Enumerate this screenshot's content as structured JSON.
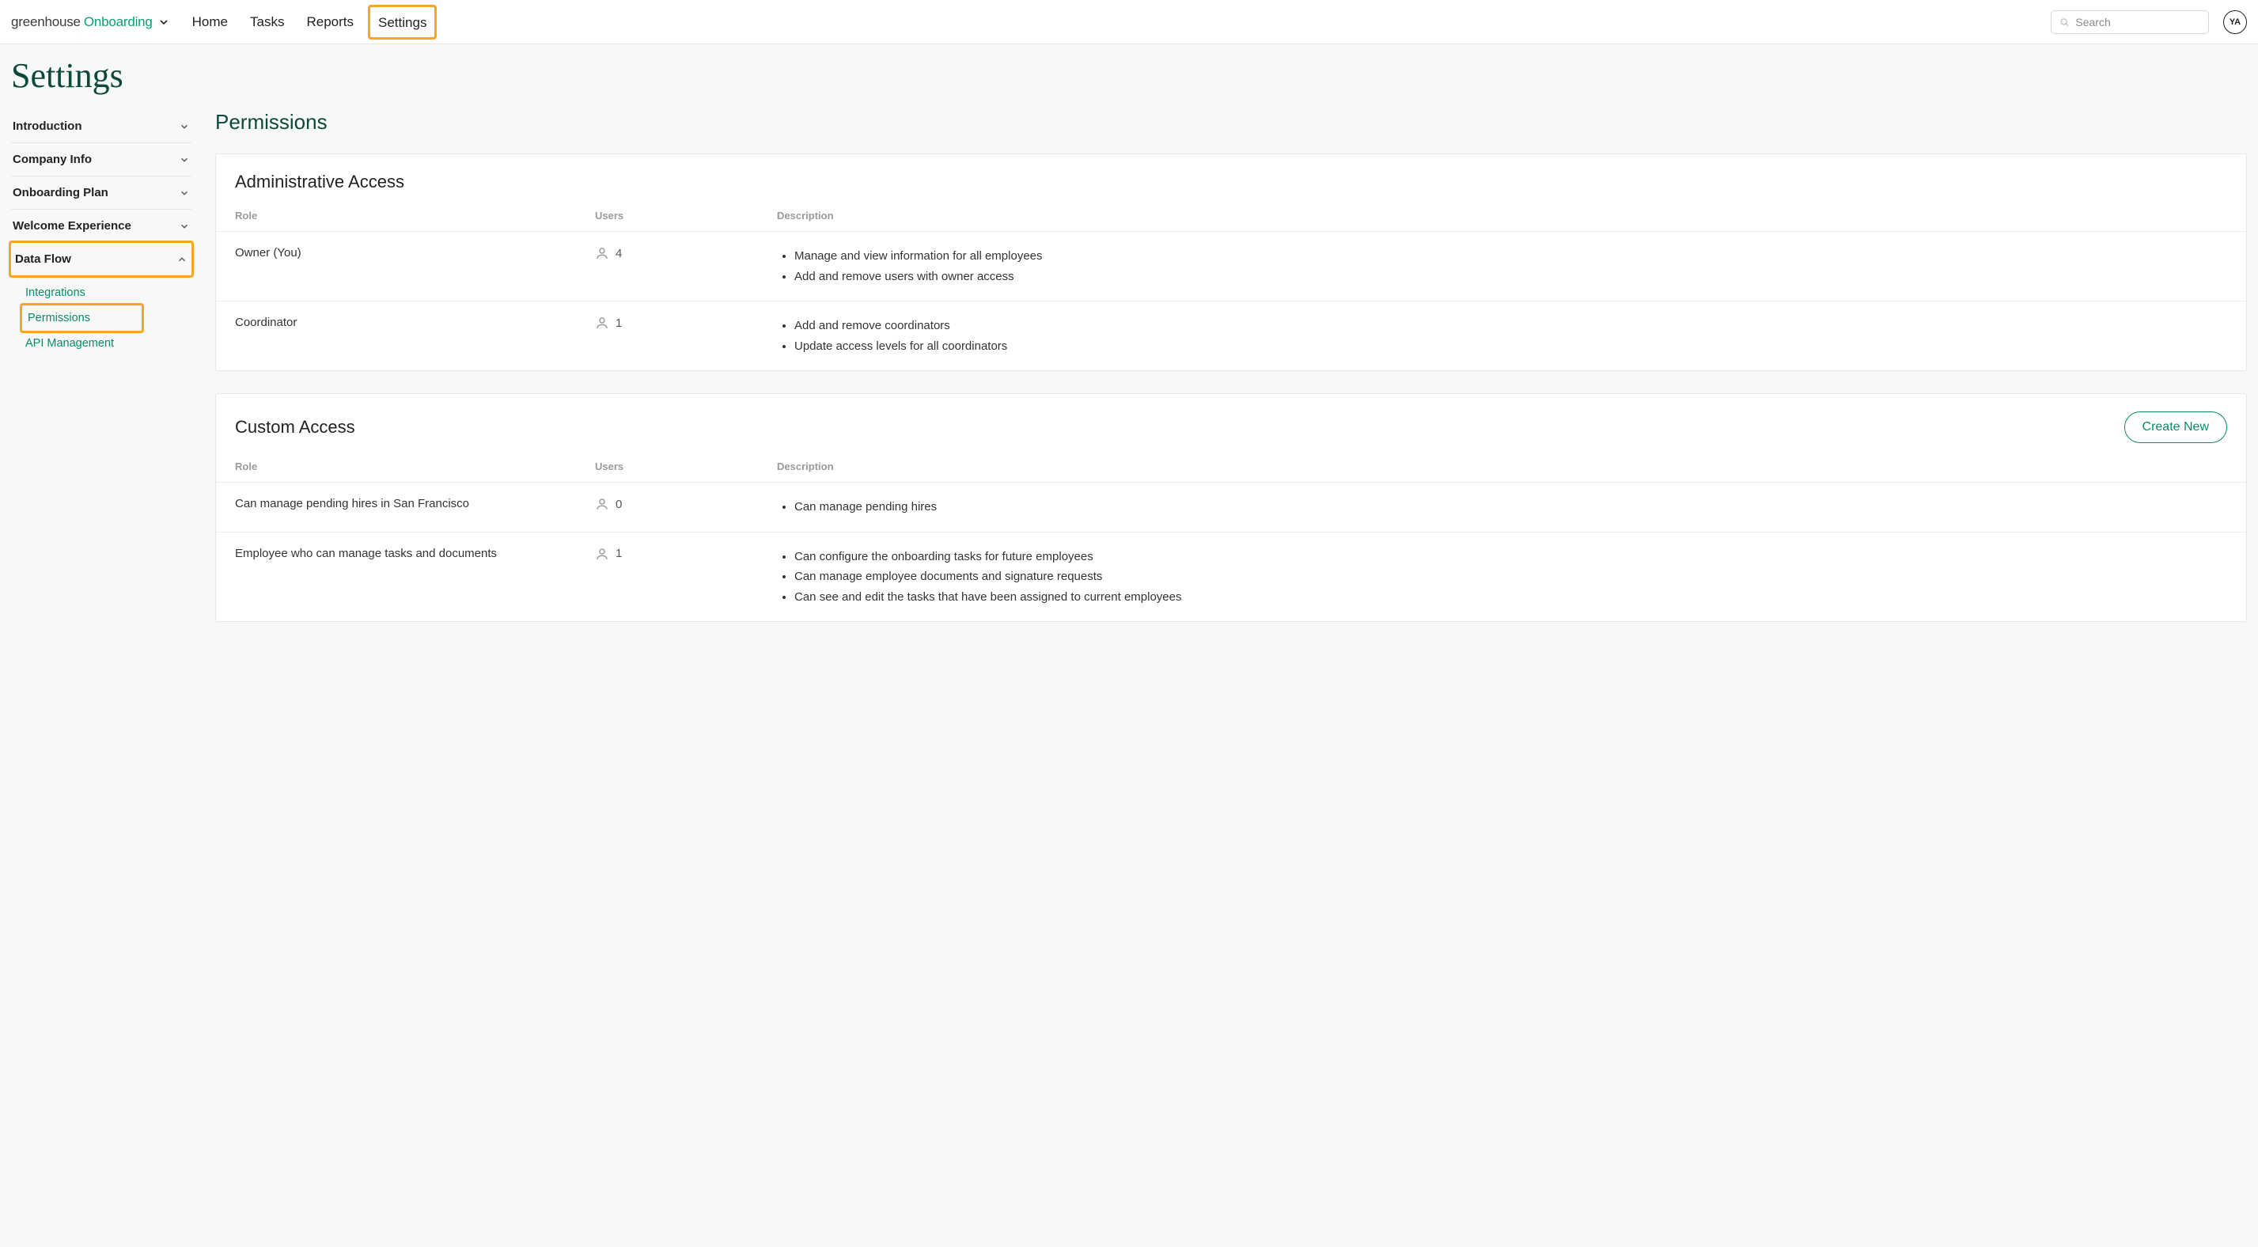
{
  "header": {
    "logo_primary": "greenhouse",
    "logo_secondary": "Onboarding",
    "nav": [
      "Home",
      "Tasks",
      "Reports",
      "Settings"
    ],
    "active_nav_index": 3,
    "search_placeholder": "Search",
    "avatar_initials": "YA"
  },
  "page": {
    "title": "Settings",
    "main_title": "Permissions"
  },
  "sidebar": {
    "groups": [
      {
        "label": "Introduction",
        "expanded": false
      },
      {
        "label": "Company Info",
        "expanded": false
      },
      {
        "label": "Onboarding Plan",
        "expanded": false
      },
      {
        "label": "Welcome Experience",
        "expanded": false
      },
      {
        "label": "Data Flow",
        "expanded": true,
        "highlight": true,
        "items": [
          {
            "label": "Integrations"
          },
          {
            "label": "Permissions",
            "active": true,
            "highlight": true
          },
          {
            "label": "API Management"
          }
        ]
      }
    ]
  },
  "panels": {
    "admin": {
      "title": "Administrative Access",
      "columns": [
        "Role",
        "Users",
        "Description"
      ],
      "rows": [
        {
          "role": "Owner (You)",
          "users": "4",
          "desc": [
            "Manage and view information for all employees",
            "Add and remove users with owner access"
          ]
        },
        {
          "role": "Coordinator",
          "users": "1",
          "desc": [
            "Add and remove coordinators",
            "Update access levels for all coordinators"
          ]
        }
      ]
    },
    "custom": {
      "title": "Custom Access",
      "create_label": "Create New",
      "columns": [
        "Role",
        "Users",
        "Description"
      ],
      "rows": [
        {
          "role": "Can manage pending hires in San Francisco",
          "users": "0",
          "desc": [
            "Can manage pending hires"
          ]
        },
        {
          "role": "Employee who can manage tasks and documents",
          "users": "1",
          "desc": [
            "Can configure the onboarding tasks for future employees",
            "Can manage employee documents and signature requests",
            "Can see and edit the tasks that have been assigned to current employees"
          ]
        }
      ]
    }
  }
}
